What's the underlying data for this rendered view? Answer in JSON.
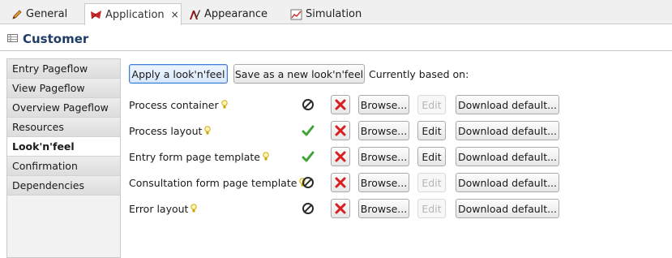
{
  "tabs": [
    {
      "label": "General",
      "icon": "pencil-icon",
      "active": false
    },
    {
      "label": "Application",
      "icon": "application-icon",
      "active": true,
      "close": "×"
    },
    {
      "label": "Appearance",
      "icon": "appearance-icon",
      "active": false
    },
    {
      "label": "Simulation",
      "icon": "simulation-icon",
      "active": false
    }
  ],
  "header": {
    "title": "Customer",
    "icon": "form-icon"
  },
  "sidebar": {
    "items": [
      {
        "label": "Entry Pageflow"
      },
      {
        "label": "View Pageflow"
      },
      {
        "label": "Overview Pageflow"
      },
      {
        "label": "Resources"
      },
      {
        "label": "Look'n'feel",
        "active": true
      },
      {
        "label": "Confirmation"
      },
      {
        "label": "Dependencies"
      }
    ]
  },
  "toolbar": {
    "apply_label": "Apply a look'n'feel",
    "save_label": "Save as a new look'n'feel",
    "based_on_label": "Currently based on:"
  },
  "rows": [
    {
      "label": "Process container",
      "status": "not-set",
      "edit_enabled": false
    },
    {
      "label": "Process layout",
      "status": "set",
      "edit_enabled": true
    },
    {
      "label": "Entry form page template",
      "status": "set",
      "edit_enabled": true
    },
    {
      "label": "Consultation form page template",
      "status": "not-set",
      "edit_enabled": false
    },
    {
      "label": "Error layout",
      "status": "not-set",
      "edit_enabled": false
    }
  ],
  "row_buttons": {
    "browse_label": "Browse...",
    "edit_label": "Edit",
    "download_label": "Download default..."
  },
  "colors": {
    "header_title": "#1f3d66",
    "delete_red": "#d81e1e",
    "check_green": "#3fa535",
    "primary_border": "#3d7bd9"
  }
}
